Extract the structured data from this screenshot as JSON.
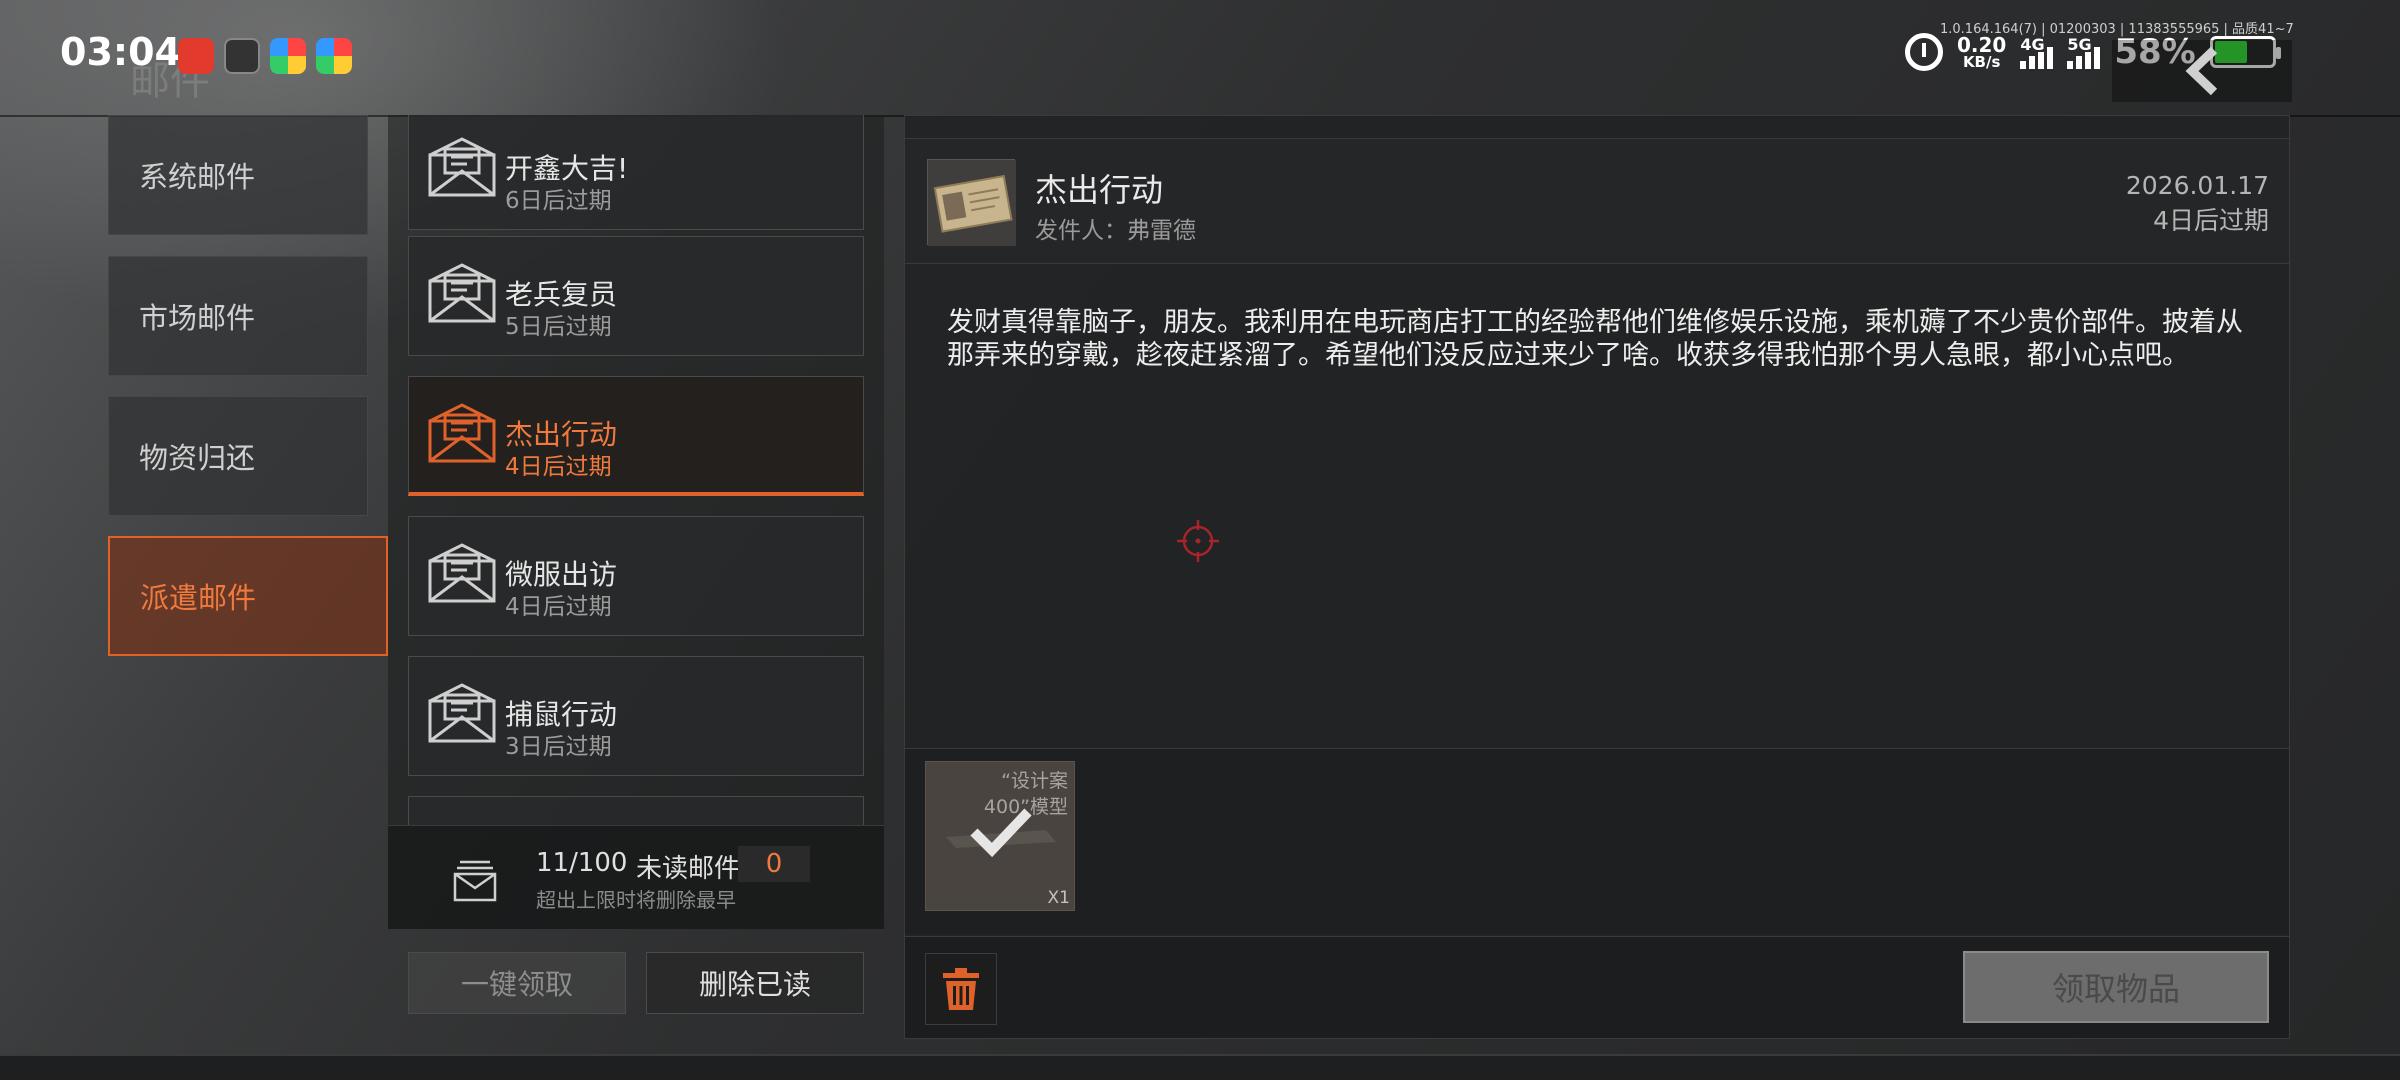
{
  "status_bar": {
    "time": "03:04",
    "build_info": "1.0.164.164(7) | 01200303 | 11383555965 | 品质41~7",
    "net_speed_value": "0.20",
    "net_speed_unit": "KB/s",
    "signal_1_label": "4G",
    "signal_2_label": "5G",
    "battery_percent": "58%",
    "battery_level": 0.58,
    "battery_color": "#37e33a"
  },
  "page": {
    "title": "邮件",
    "back_icon": "chevron-left-icon"
  },
  "categories": [
    {
      "label": "系统邮件"
    },
    {
      "label": "市场邮件"
    },
    {
      "label": "物资归还"
    },
    {
      "label": "派遣邮件"
    }
  ],
  "mails": [
    {
      "title": "开鑫大吉!",
      "expiry": "6日后过期"
    },
    {
      "title": "老兵复员",
      "expiry": "5日后过期"
    },
    {
      "title": "杰出行动",
      "expiry": "4日后过期"
    },
    {
      "title": "微服出访",
      "expiry": "4日后过期"
    },
    {
      "title": "捕鼠行动",
      "expiry": "3日后过期"
    }
  ],
  "counter": {
    "count": "11/100",
    "unread_label": "未读邮件",
    "unread_count": "0",
    "hint": "超出上限时将删除最早"
  },
  "actions": {
    "claim_all": "一键领取",
    "delete_read": "删除已读"
  },
  "detail": {
    "title": "杰出行动",
    "sender": "发件人：弗雷德",
    "date": "2026.01.17",
    "expiry": "4日后过期",
    "body": "发财真得靠脑子，朋友。我利用在电玩商店打工的经验帮他们维修娱乐设施，乘机薅了不少贵价部件。披着从那弄来的穿戴，趁夜赶紧溜了。希望他们没反应过来少了啥。收获多得我怕那个男人急眼，都小心点吧。",
    "attachment": {
      "name_line1": "“设计案",
      "name_line2": "400”模型",
      "quantity": "X1"
    },
    "claim_button": "领取物品"
  },
  "colors": {
    "accent": "#e0622b",
    "accent_text": "#f07a3e"
  }
}
